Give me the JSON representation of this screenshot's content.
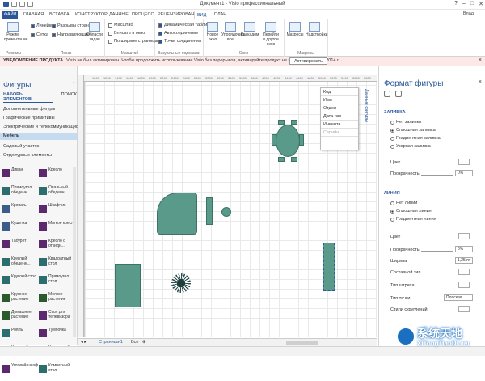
{
  "window": {
    "title": "Документ1 - Visio профессиональный",
    "user": "Влад"
  },
  "tabs": [
    "ФАЙЛ",
    "ГЛАВНАЯ",
    "ВСТАВКА",
    "КОНСТРУКТОР",
    "ДАННЫЕ",
    "ПРОЦЕСС",
    "РЕЦЕНЗИРОВАНИЕ",
    "ВИД",
    "ПЛАН"
  ],
  "active_tab": "ВИД",
  "ribbon": {
    "groups": [
      {
        "label": "Режимы",
        "buttons": [
          "Режим презентации"
        ]
      },
      {
        "label": "Показ",
        "checks": [
          {
            "label": "Линейки",
            "on": true
          },
          {
            "label": "Разрывы страниц",
            "on": true
          },
          {
            "label": "Сетка",
            "on": true
          },
          {
            "label": "Направляющие",
            "on": true
          }
        ],
        "buttons": [
          "Области задач"
        ]
      },
      {
        "label": "Масштаб",
        "buttons": [
          "Масштаб",
          "Вписать в окно",
          "По ширине страницы"
        ]
      },
      {
        "label": "Визуальные подсказки",
        "checks": [
          {
            "label": "Динамическая таблица",
            "on": true
          },
          {
            "label": "Автосоединение",
            "on": true
          },
          {
            "label": "Точки соединения",
            "on": true
          }
        ]
      },
      {
        "label": "Окно",
        "buttons": [
          "Новое окно",
          "Упорядочить все",
          "Каскадом",
          "Перейти в другое окно"
        ]
      },
      {
        "label": "Макросы",
        "buttons": [
          "Макросы",
          "Надстройки"
        ]
      }
    ]
  },
  "message_bar": {
    "title": "УВЕДОМЛЕНИЕ ПРОДУКТА",
    "text": "Visio не был активирован. Чтобы продолжить использование Visio без перерывов, активируйте продукт не позднее 28 марта 2014 г.",
    "action": "Активировать"
  },
  "shapes_pane": {
    "title": "Фигуры",
    "subtabs": [
      "НАБОРЫ ЭЛЕМЕНТОВ",
      "ПОИСК"
    ],
    "stencils": [
      "Дополнительные фигуры",
      "Графические примитивы",
      "Электрические и телекоммуникацион...",
      "Мебель",
      "Садовый участок",
      "Структурные элементы"
    ],
    "selected_stencil": "Мебель",
    "items": [
      {
        "label": "Диван",
        "color": "#5b2a6e"
      },
      {
        "label": "Кресло",
        "color": "#5b2a6e"
      },
      {
        "label": "Прямоугол. обеденн...",
        "color": "#2c6e6e"
      },
      {
        "label": "Овальный обеденн...",
        "color": "#2c6e6e"
      },
      {
        "label": "Кровать",
        "color": "#3a5d8a"
      },
      {
        "label": "Шкафчик",
        "color": "#5b2a6e"
      },
      {
        "label": "Кушетка",
        "color": "#3a5d8a"
      },
      {
        "label": "Мягкое кресло",
        "color": "#5b2a6e"
      },
      {
        "label": "Табурет",
        "color": "#5b2a6e"
      },
      {
        "label": "Кресло с откидн...",
        "color": "#5b2a6e"
      },
      {
        "label": "Круглый обеденн...",
        "color": "#2c6e6e"
      },
      {
        "label": "Квадратный стол",
        "color": "#2c6e6e"
      },
      {
        "label": "Круглый стол",
        "color": "#2c6e6e"
      },
      {
        "label": "Прямоугол. стол",
        "color": "#2c6e6e"
      },
      {
        "label": "Крупное растение",
        "color": "#2c5a2c"
      },
      {
        "label": "Мелкое растение",
        "color": "#2c5a2c"
      },
      {
        "label": "Домашнее растение",
        "color": "#2c5a2c"
      },
      {
        "label": "Стол для телевизора",
        "color": "#5b2a6e"
      },
      {
        "label": "Рояль",
        "color": "#2c6e6e"
      },
      {
        "label": "Тумбочка",
        "color": "#5b2a6e"
      },
      {
        "label": "Книжный шкаф",
        "color": "#5b2a6e"
      },
      {
        "label": "Комнатный...",
        "color": "#3a5d8a"
      },
      {
        "label": "Угловой шкаф",
        "color": "#5b2a6e"
      },
      {
        "label": "Комнатный стол",
        "color": "#2c6e6e"
      }
    ]
  },
  "ruler_labels": [
    "1000",
    "1200",
    "1400",
    "1600",
    "1800",
    "2000",
    "2200",
    "2400",
    "2600",
    "2800",
    "3000",
    "3200",
    "3400",
    "3600",
    "3800",
    "4000",
    "4200",
    "4400",
    "4600",
    "4800",
    "5000",
    "5200",
    "5400",
    "5600",
    "5800"
  ],
  "data_panel": {
    "title": "Данные фигуры",
    "rows": [
      "Код",
      "Имя",
      "Отдел",
      "Дата изо",
      "Инвента",
      "Серийн"
    ]
  },
  "bottom": {
    "page": "Страница-1",
    "all": "Все",
    "add": "⊕"
  },
  "format_pane": {
    "title": "Формат фигуры",
    "fill_section": "ЗАЛИВКА",
    "fill_options": [
      {
        "label": "Нет заливки",
        "on": false
      },
      {
        "label": "Сплошная заливка",
        "on": true
      },
      {
        "label": "Градиентная заливка",
        "on": false
      },
      {
        "label": "Узорная заливка",
        "on": false
      }
    ],
    "fill_props": [
      {
        "label": "Цвет"
      },
      {
        "label": "Прозрачность",
        "value": "0%"
      }
    ],
    "line_section": "ЛИНИЯ",
    "line_options": [
      {
        "label": "Нет линий",
        "on": false
      },
      {
        "label": "Сплошная линия",
        "on": true
      },
      {
        "label": "Градиентная линия",
        "on": false
      }
    ],
    "line_props": [
      {
        "label": "Цвет"
      },
      {
        "label": "Прозрачность",
        "value": "0%"
      },
      {
        "label": "Ширина",
        "value": "1,25 пт"
      },
      {
        "label": "Составной тип"
      },
      {
        "label": "Тип штриха"
      },
      {
        "label": "Тип точки",
        "value": "Плоская"
      },
      {
        "label": "Стили скруглений"
      }
    ]
  },
  "watermark": {
    "text": "系统天地",
    "sub": "XiTongTianDi.net"
  },
  "colors": {
    "accent": "#2b579a",
    "shape_fill": "#5a9a8a",
    "message_bg": "#fde8e8"
  }
}
